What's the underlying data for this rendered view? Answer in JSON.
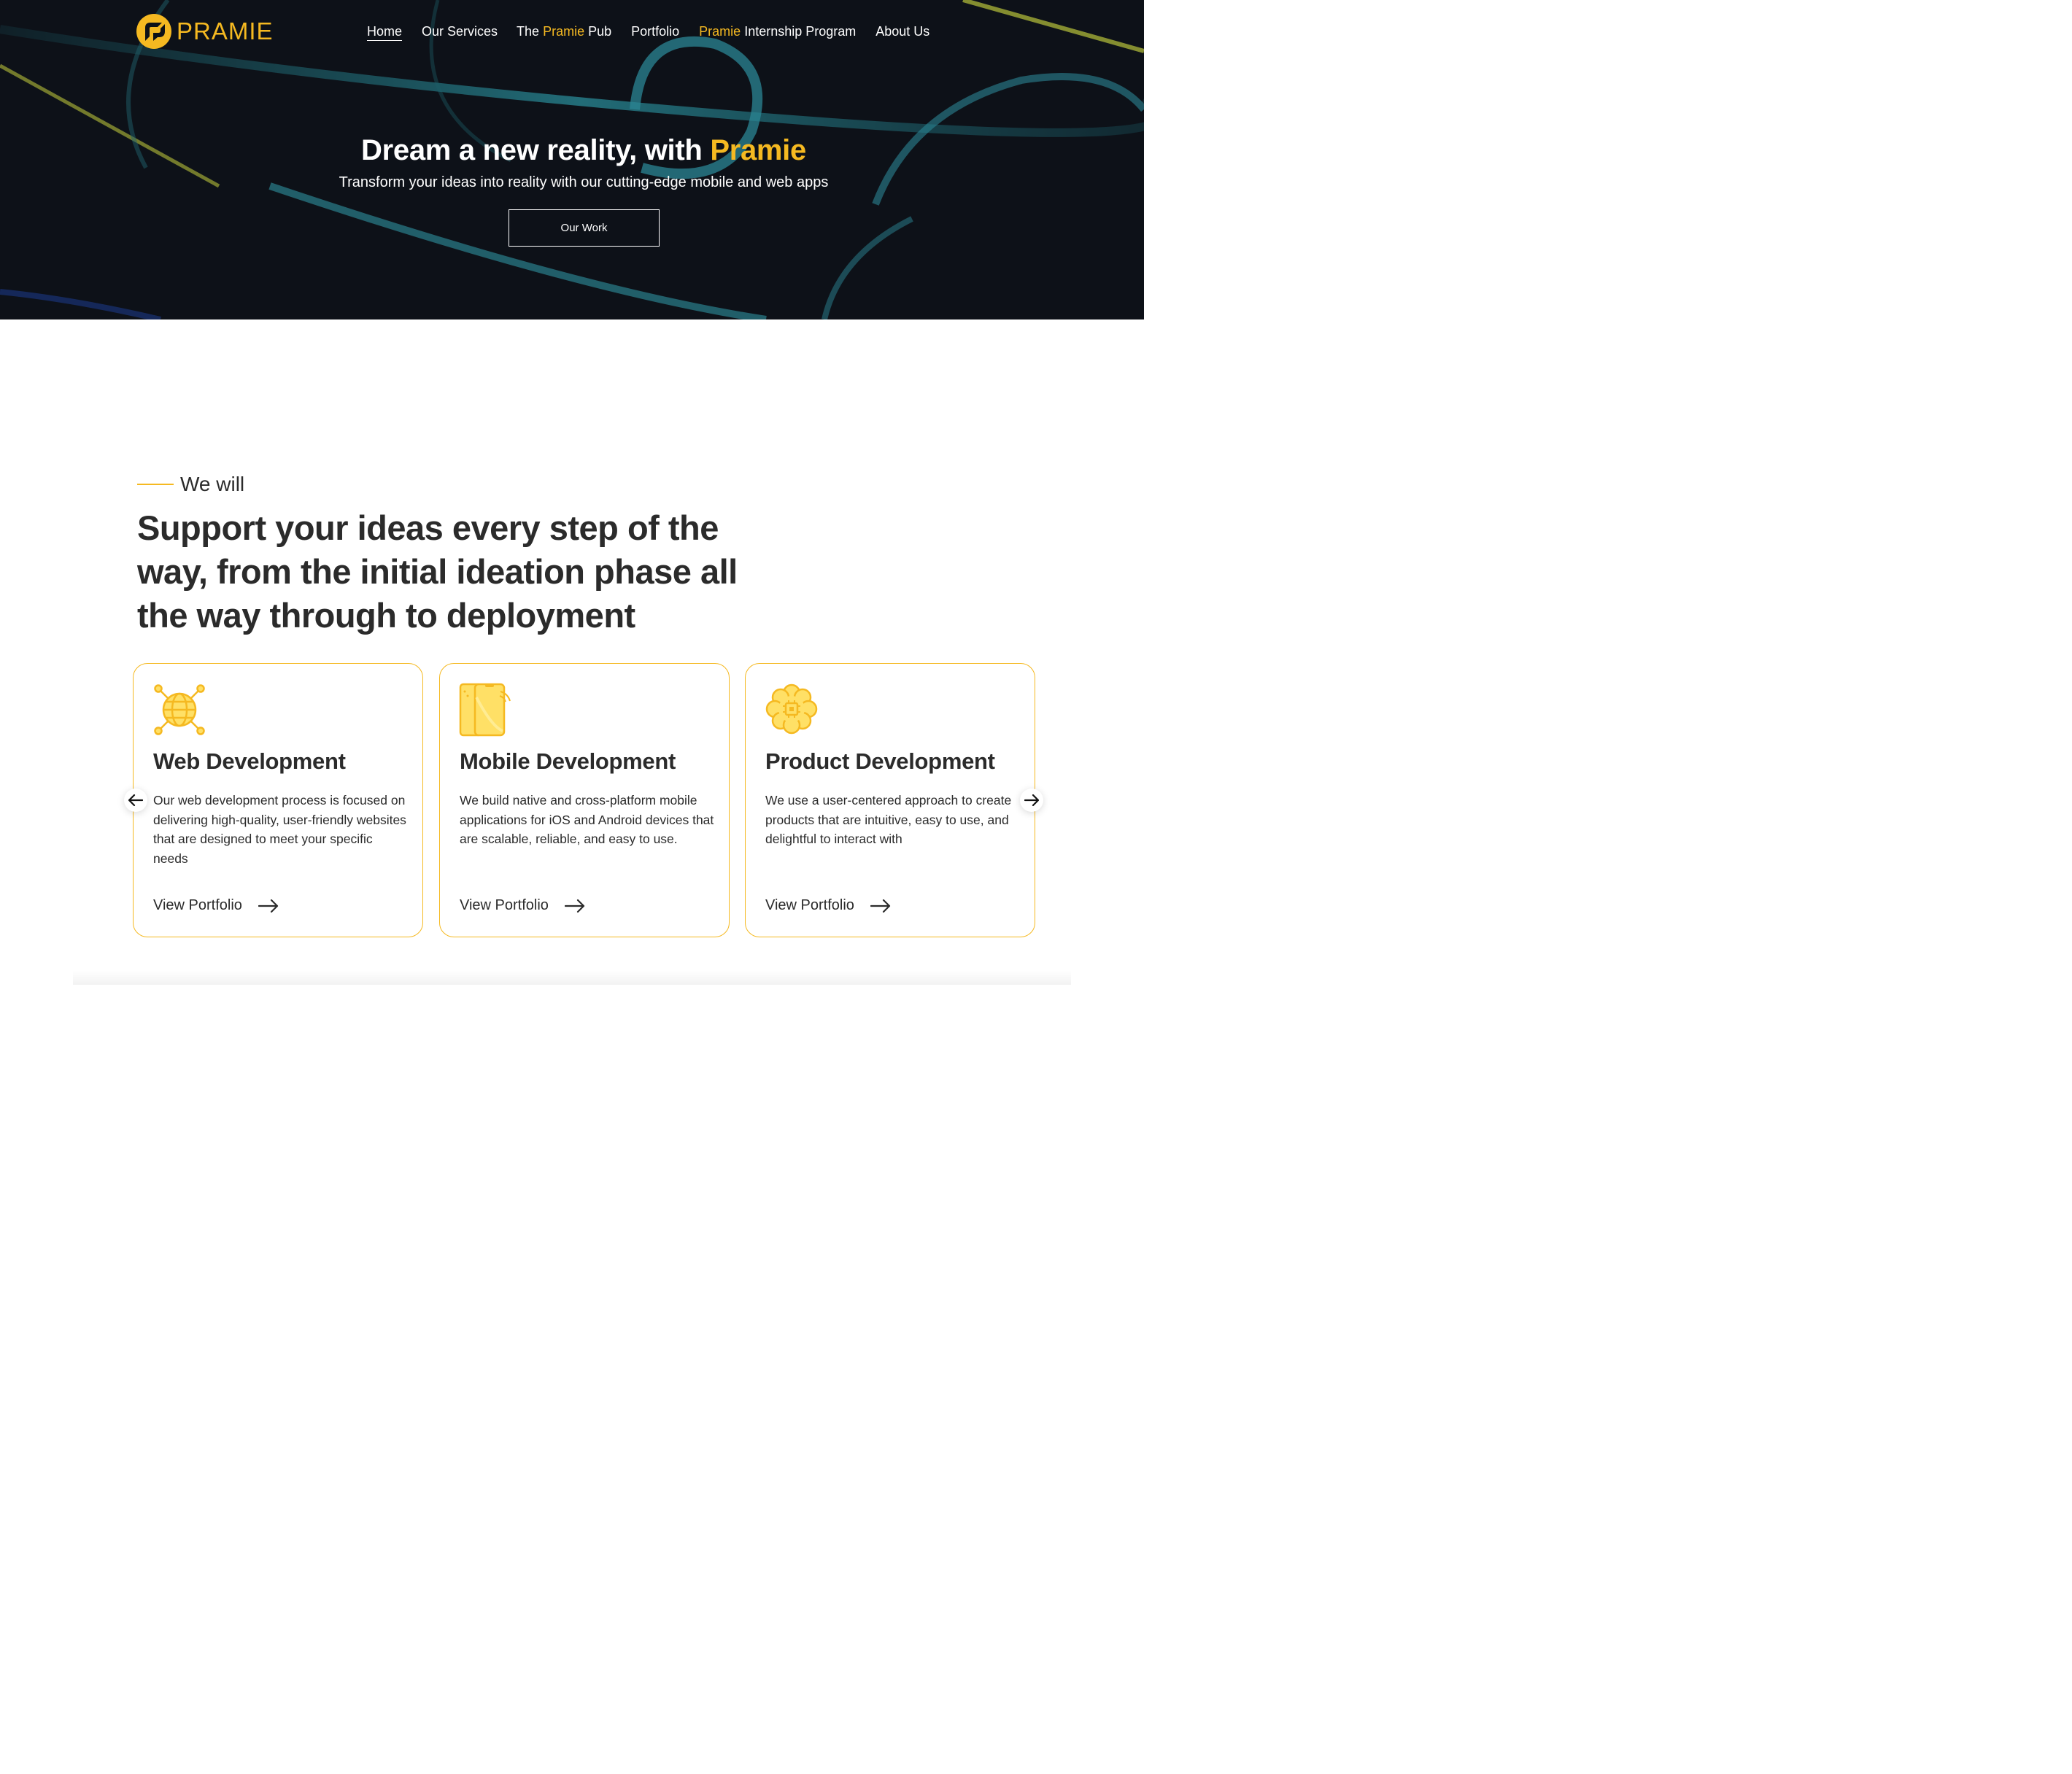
{
  "brand": {
    "name": "PRAMIE",
    "accent_color": "#f5b921"
  },
  "nav": {
    "items": [
      {
        "label": "Home",
        "active": true
      },
      {
        "label": "Our Services"
      },
      {
        "prefix": "The ",
        "accent": "Pramie",
        "suffix": " Pub"
      },
      {
        "label": "Portfolio"
      },
      {
        "prefix": "",
        "accent": "Pramie",
        "suffix": " Internship Program"
      },
      {
        "label": "About Us"
      }
    ]
  },
  "hero": {
    "title_prefix": "Dream a new reality, with ",
    "title_accent": "Pramie",
    "subtitle": "Transform your ideas into reality with our cutting-edge mobile and web apps",
    "cta_label": "Our Work"
  },
  "section": {
    "eyebrow": "We will",
    "heading": "Support your ideas every step of the way, from the initial ideation phase all the way through to deployment"
  },
  "cards": [
    {
      "icon": "globe-network-icon",
      "title": "Web Development",
      "description": "Our web development process is focused on delivering high-quality, user-friendly websites that are designed to meet your specific needs",
      "link": "View Portfolio"
    },
    {
      "icon": "mobile-phones-icon",
      "title": "Mobile Development",
      "description": "We build native and cross-platform mobile applications for iOS and Android devices that are scalable, reliable, and easy to use.",
      "link": "View Portfolio"
    },
    {
      "icon": "brain-chip-icon",
      "title": "Product Development",
      "description": "We use a user-centered approach to create products that are intuitive, easy to use, and delightful to interact with",
      "link": "View Portfolio"
    }
  ]
}
